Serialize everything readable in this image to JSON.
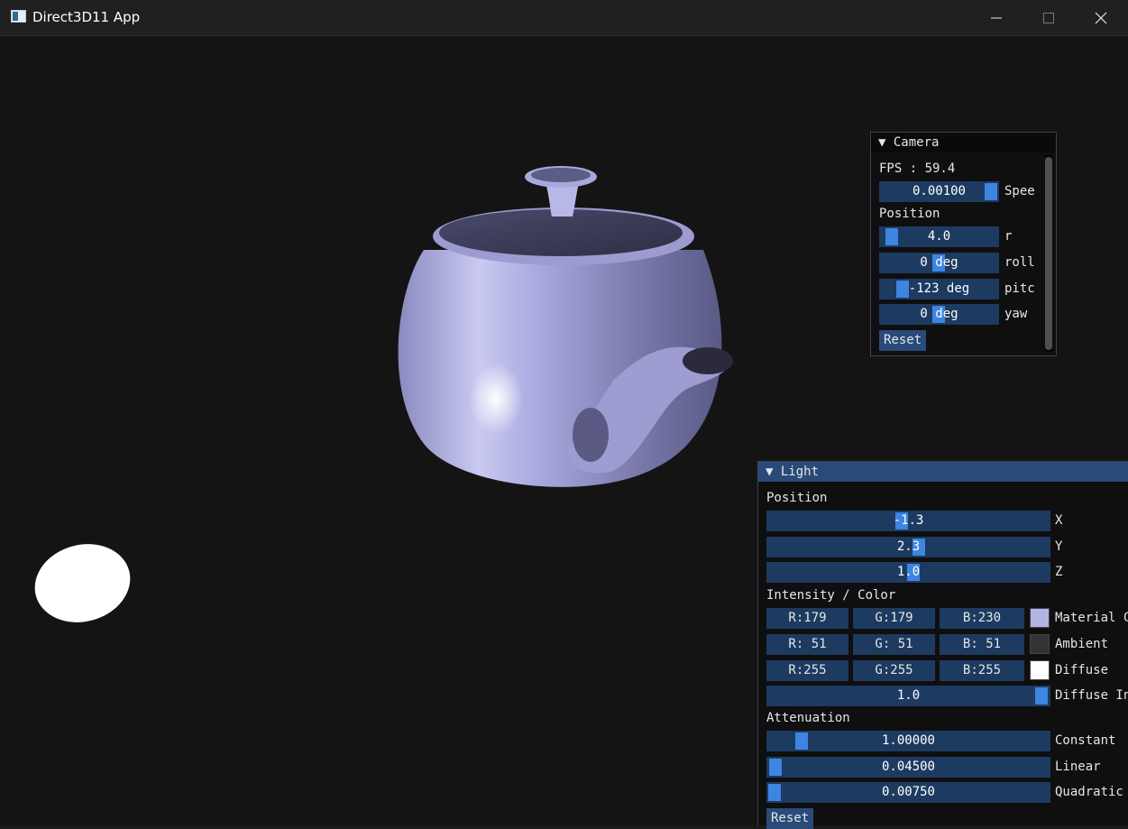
{
  "window": {
    "title": "Direct3D11 App",
    "minimize_icon": "minimize-icon",
    "maximize_icon": "maximize-icon",
    "close_icon": "close-icon"
  },
  "colors": {
    "background": "#141414",
    "frame_bg": "#1d3a61",
    "grab": "#3d85e0",
    "title_active": "#2a4a7a",
    "teapot": "#b3b3e6"
  },
  "camera": {
    "title": "Camera",
    "fps": "FPS : 59.4",
    "speed": {
      "value": "0.00100",
      "label": "Spee",
      "level": 1.0
    },
    "position_header": "Position",
    "r": {
      "value": "4.0",
      "label": "r"
    },
    "roll": {
      "value": "0 deg",
      "label": "roll"
    },
    "pitch": {
      "value": "-123 deg",
      "label": "pitc"
    },
    "yaw": {
      "value": "0 deg",
      "label": "yaw"
    },
    "reset": "Reset"
  },
  "light": {
    "title": "Light",
    "position_header": "Position",
    "x": {
      "value": "-1.3",
      "label": "X"
    },
    "y": {
      "value": "2.3",
      "label": "Y"
    },
    "z": {
      "value": "1.0",
      "label": "Z"
    },
    "color_header": "Intensity / Color",
    "material": {
      "r": "R:179",
      "g": "G:179",
      "b": "B:230",
      "color": "#b3b3e6",
      "label": "Material C"
    },
    "ambient": {
      "r": "R: 51",
      "g": "G: 51",
      "b": "B: 51",
      "color": "#333333",
      "label": "Ambient"
    },
    "diffuse": {
      "r": "R:255",
      "g": "G:255",
      "b": "B:255",
      "color": "#ffffff",
      "label": "Diffuse"
    },
    "diffuse_intensity": {
      "value": "1.0",
      "label": "Diffuse In"
    },
    "attenuation_header": "Attenuation",
    "constant": {
      "value": "1.00000",
      "label": "Constant"
    },
    "linear": {
      "value": "0.04500",
      "label": "Linear"
    },
    "quadratic": {
      "value": "0.00750",
      "label": "Quadratic"
    },
    "reset": "Reset"
  }
}
